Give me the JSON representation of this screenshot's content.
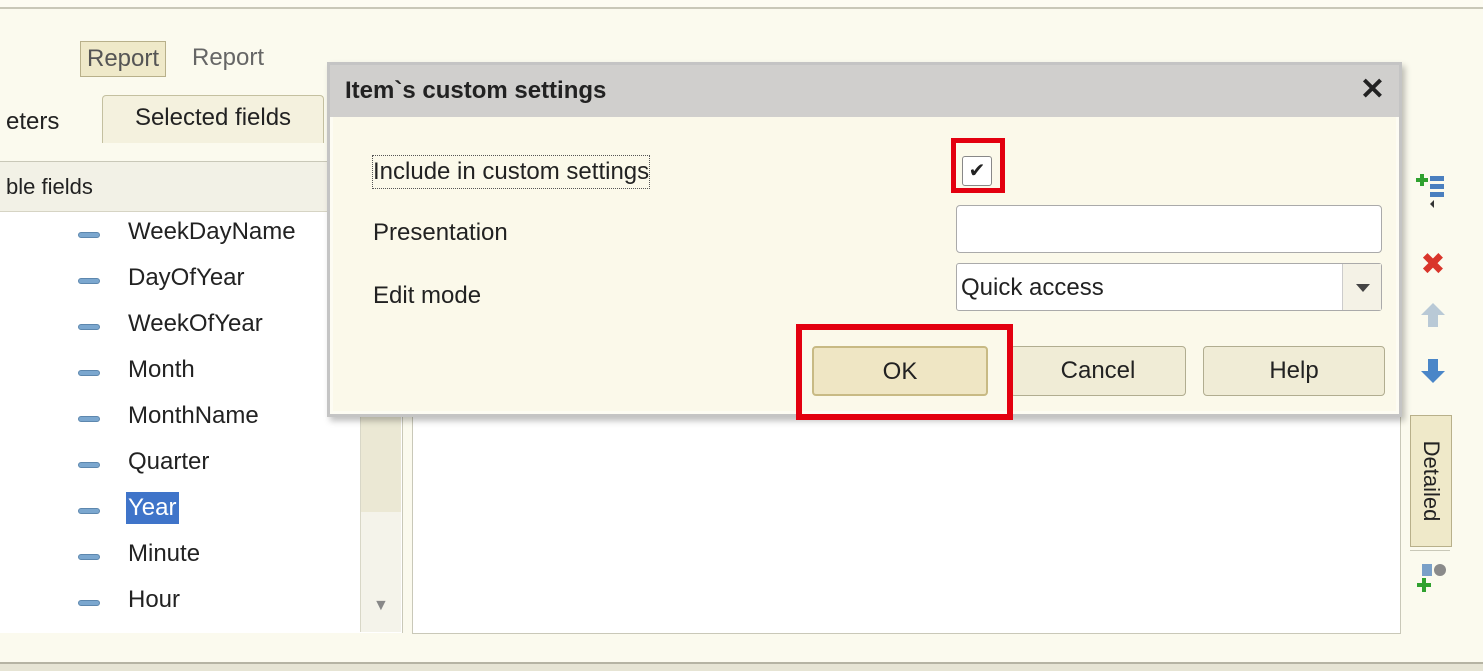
{
  "header": {
    "report_button_label": "Report",
    "report_label": "Report"
  },
  "tabs": {
    "parameters": "eters",
    "selected_fields": "Selected fields"
  },
  "left_panel": {
    "header": "ble fields",
    "fields": [
      {
        "label": "WeekDayName",
        "selected": false
      },
      {
        "label": "DayOfYear",
        "selected": false
      },
      {
        "label": "WeekOfYear",
        "selected": false
      },
      {
        "label": "Month",
        "selected": false
      },
      {
        "label": "MonthName",
        "selected": false
      },
      {
        "label": "Quarter",
        "selected": false
      },
      {
        "label": "Year",
        "selected": true
      },
      {
        "label": "Minute",
        "selected": false
      },
      {
        "label": "Hour",
        "selected": false
      }
    ]
  },
  "toolbar": {
    "add_icon": "add-field-icon",
    "delete_icon": "delete-icon",
    "up_icon": "arrow-up-icon",
    "down_icon": "arrow-down-icon",
    "detailed_label": "Detailed",
    "settings_icon": "add-settings-icon"
  },
  "dialog": {
    "title": "Item`s custom settings",
    "close_glyph": "✕",
    "include_label": "Include in custom settings",
    "include_checked": true,
    "presentation_label": "Presentation",
    "presentation_value": "",
    "edit_mode_label": "Edit mode",
    "edit_mode_value": "Quick access",
    "ok_label": "OK",
    "cancel_label": "Cancel",
    "help_label": "Help"
  },
  "colors": {
    "highlight_box": "#e3000f",
    "selection": "#3f74c9"
  }
}
